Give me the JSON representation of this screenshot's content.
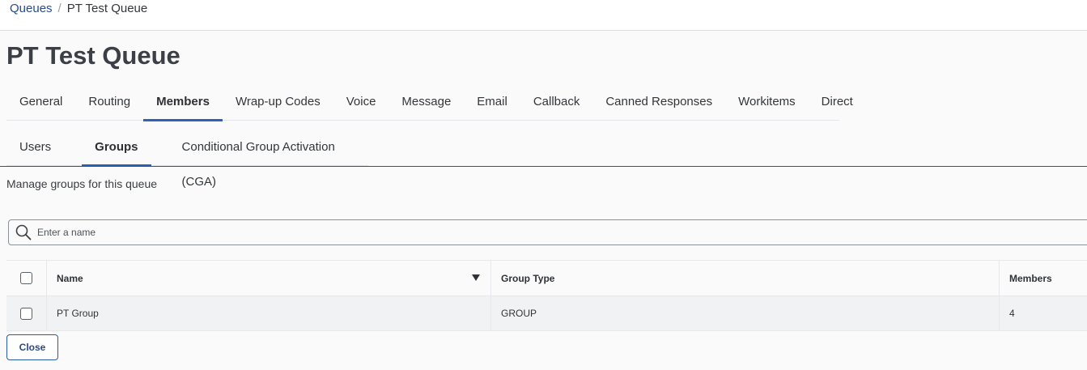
{
  "breadcrumb": {
    "parent": "Queues",
    "separator": "/",
    "current": "PT Test Queue"
  },
  "page_title": "PT Test Queue",
  "main_tabs": [
    {
      "label": "General"
    },
    {
      "label": "Routing"
    },
    {
      "label": "Members",
      "active": true
    },
    {
      "label": "Wrap-up Codes"
    },
    {
      "label": "Voice"
    },
    {
      "label": "Message"
    },
    {
      "label": "Email"
    },
    {
      "label": "Callback"
    },
    {
      "label": "Canned Responses"
    },
    {
      "label": "Workitems"
    },
    {
      "label": "Direct"
    }
  ],
  "sub_tabs": [
    {
      "label": "Users"
    },
    {
      "label": "Groups",
      "active": true
    },
    {
      "label": "Conditional Group Activation (CGA)"
    }
  ],
  "description": "Manage groups for this queue",
  "search": {
    "placeholder": "Enter a name",
    "value": ""
  },
  "table": {
    "columns": {
      "name": "Name",
      "group_type": "Group Type",
      "members": "Members"
    },
    "rows": [
      {
        "name": "PT Group",
        "group_type": "GROUP",
        "members": "4"
      }
    ]
  },
  "close_label": "Close",
  "colors": {
    "accent": "#2a63b8",
    "link": "#2a4a8a",
    "title": "#3c4046"
  }
}
